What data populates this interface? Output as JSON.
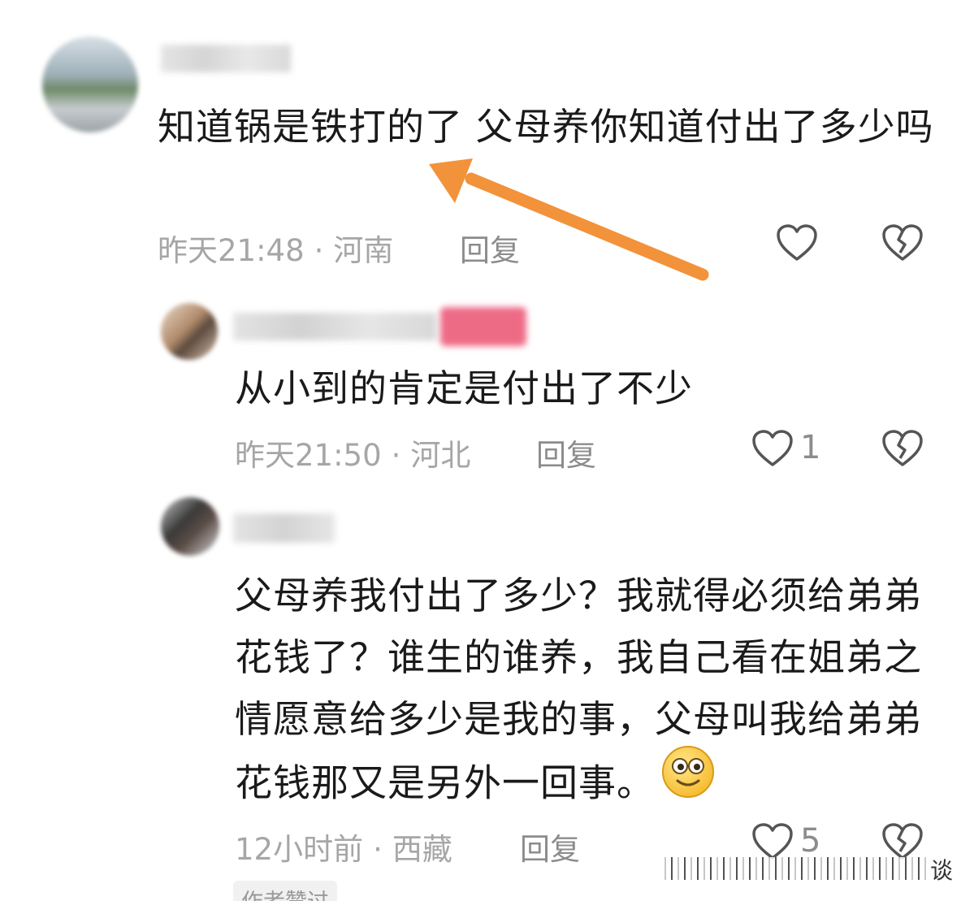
{
  "comments": [
    {
      "text": "知道锅是铁打的了 父母养你知道付出了多少吗",
      "time": "昨天21:48",
      "location": "河南",
      "reply_label": "回复",
      "like_count": ""
    },
    {
      "text": "从小到的肯定是付出了不少",
      "time": "昨天21:50",
      "location": "河北",
      "reply_label": "回复",
      "like_count": "1"
    },
    {
      "text": "父母养我付出了多少？我就得必须给弟弟花钱了？谁生的谁养，我自己看在姐弟之情愿意给多少是我的事，父母叫我给弟弟花钱那又是另外一回事。",
      "time": "12小时前",
      "location": "西藏",
      "reply_label": "回复",
      "like_count": "5",
      "badge": "作者赞过"
    }
  ],
  "separator": "·",
  "watermark": "谈",
  "icons": {
    "like": "heart-outline-icon",
    "dislike": "broken-heart-icon",
    "emoji": "smiling-face-emoji",
    "arrow": "orange-arrow"
  },
  "colors": {
    "arrow": "#f2923a",
    "meta": "#a6a6a6",
    "text": "#1a1a1a",
    "name_pink": "#ee6b86"
  }
}
